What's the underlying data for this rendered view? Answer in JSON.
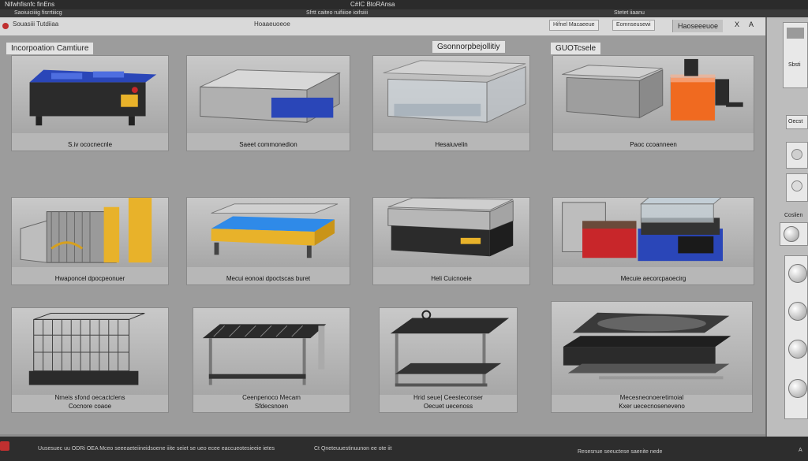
{
  "window": {
    "title_left": "Nifwhfisnfc finEns",
    "title_center": "C#IC BtoRAnsa",
    "menu_left": "Saoiuiciiiig fisrrtiiicg",
    "menu_center": "Sfrtt caiteo ruifiiioe ioifsiiii",
    "menu_right": "Stetet iiaanu"
  },
  "toolbar": {
    "left_label": "Souasiii Tutdiiaa",
    "center_label": "Hoaaeuoeoe",
    "pill_1": "Hifnel Macaeeue",
    "pill_2": "Eomnseusewi",
    "tab_label": "Haoseeeuoe",
    "ctl_x": "X",
    "ctl_dots": "A"
  },
  "sections": {
    "left": "Incorpoation Camtiure",
    "middle": "Gsonnorpbejollitiy",
    "right": "GUOTcsele"
  },
  "products": [
    {
      "caption": "S.iv ococnecnle",
      "caption2": ""
    },
    {
      "caption": "Saeet commonedion",
      "caption2": ""
    },
    {
      "caption": "Hesaiuvelin",
      "caption2": ""
    },
    {
      "caption": "Paoc ccoanneen",
      "caption2": ""
    },
    {
      "caption": "Hwaponcel dpocpeonuer",
      "caption2": ""
    },
    {
      "caption": "Mecui eonoai dpoctscas buret",
      "caption2": ""
    },
    {
      "caption": "Heli Cuicnoeie",
      "caption2": ""
    },
    {
      "caption": "Mecuie aecorcpaoecirg",
      "caption2": ""
    },
    {
      "caption": "Nmeis sfond oecactclens",
      "caption2": "Cocnore coaoe"
    },
    {
      "caption": "Ceenpenoco Mecam",
      "caption2": "Sfdecsnoen"
    },
    {
      "caption": "Hrid seue| Ceesteconser",
      "caption2": "Oecuet uecenoss"
    },
    {
      "caption": "Mecesneonoeretimoial",
      "caption2": "Kxer uececnoseneveno"
    }
  ],
  "sidebar": {
    "label_1": "Sbsti",
    "label_2": "Oecst",
    "label_3": "Coslien"
  },
  "status": {
    "left": "Uusesuec uu ODRi OEA Mceo seeeaeteiineidsoene iiite seiet se ueo ecee eaccueotesieeie ietes",
    "mid": "Ct Qneteuuestinuunon ee ote iit",
    "right": "Resesnue seeuctese saenite nede",
    "right_end": "A"
  },
  "colors": {
    "blue": "#2a46b8",
    "orange": "#f06a20",
    "yellow": "#e8b22a",
    "red": "#c8262a"
  }
}
